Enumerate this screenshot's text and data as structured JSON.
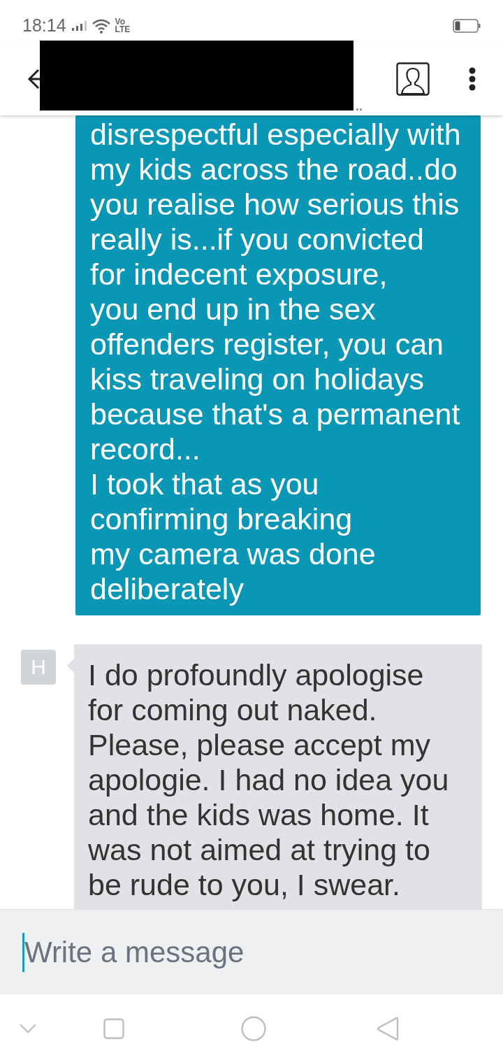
{
  "status_bar": {
    "time": "18:14",
    "network_type": [
      "Vo",
      "LTE"
    ]
  },
  "header": {
    "subtitle": ".."
  },
  "messages": [
    {
      "kind": "sent",
      "lines": [
        "disrespectful especially with",
        "my kids across the road..do",
        "you realise how serious this",
        "really is...if you convicted",
        "for indecent exposure,",
        "you end up in the sex",
        "offenders register, you can",
        "kiss traveling on holidays",
        "because that's a permanent",
        "record...",
        "I took that as you",
        "confirming breaking",
        "my camera was done",
        "deliberately"
      ]
    },
    {
      "kind": "received",
      "avatar": "H",
      "lines": [
        "I do profoundly apologise",
        "for coming out naked.",
        "Please, please accept my",
        "apologie. I had no idea you",
        "and the kids was home. It",
        "was not aimed at trying to",
        "be rude to you, I swear."
      ]
    }
  ],
  "composer": {
    "placeholder": "Write a message"
  }
}
